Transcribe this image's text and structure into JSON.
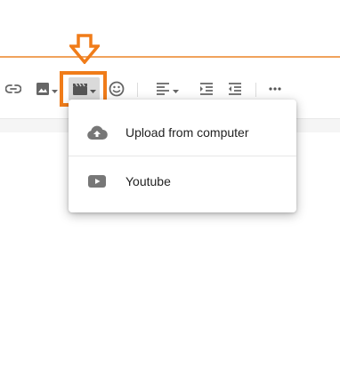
{
  "toolbar": {
    "items": [
      "link-icon",
      "image-icon",
      "video-icon",
      "emoji-icon",
      "align-left-icon",
      "indent-icon",
      "outdent-icon",
      "more-icon"
    ]
  },
  "colors": {
    "accent_orange": "#f07c19",
    "icon_gray": "#666666"
  },
  "video_menu": {
    "items": [
      {
        "label": "Upload from computer",
        "icon": "cloud-upload-icon"
      },
      {
        "label": "Youtube",
        "icon": "youtube-icon"
      }
    ]
  }
}
